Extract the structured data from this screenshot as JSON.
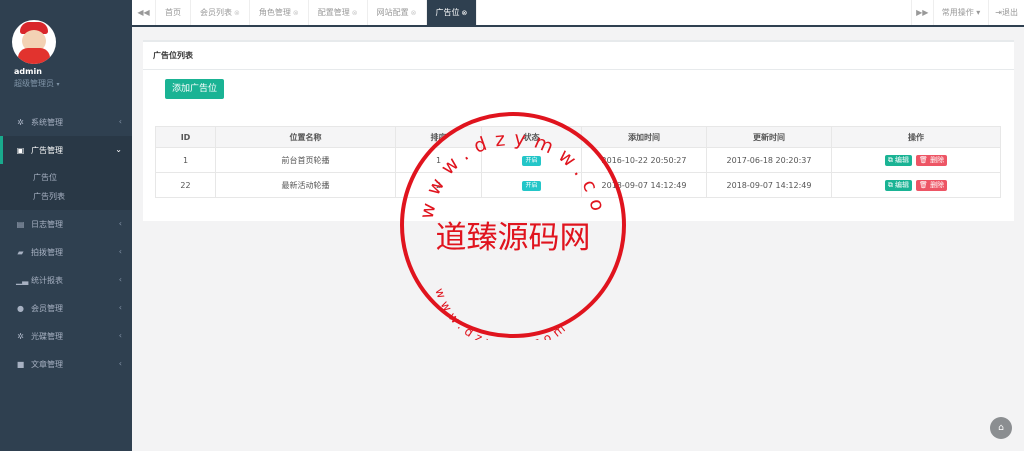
{
  "sidebar": {
    "user_name": "admin",
    "user_role": "超级管理员",
    "menu": [
      {
        "label": "系统管理",
        "icon": "gear-icon"
      },
      {
        "label": "广告管理",
        "icon": "image-icon"
      },
      {
        "label": "日志管理",
        "icon": "list-icon"
      },
      {
        "label": "拍拨管理",
        "icon": "book-icon"
      },
      {
        "label": "统计报表",
        "icon": "bar-chart-icon"
      },
      {
        "label": "会员管理",
        "icon": "user-icon"
      },
      {
        "label": "光碟管理",
        "icon": "gear-icon"
      },
      {
        "label": "文章管理",
        "icon": "list-icon"
      }
    ],
    "ad_submenu": [
      "广告位",
      "广告列表"
    ]
  },
  "tabs": {
    "items": [
      "首页",
      "会员列表",
      "角色管理",
      "配置管理",
      "网站配置",
      "广告位"
    ],
    "active_index": 5,
    "common_ops": "常用操作",
    "exit": "退出"
  },
  "panel": {
    "title": "广告位列表",
    "add_button": "添加广告位",
    "columns": [
      "ID",
      "位置名称",
      "排序",
      "状态",
      "添加时间",
      "更新时间",
      "操作"
    ],
    "rows": [
      {
        "id": "1",
        "name": "前台首页轮播",
        "sort": "1",
        "status": "开启",
        "created": "2016-10-22 20:50:27",
        "updated": "2017-06-18 20:20:37"
      },
      {
        "id": "22",
        "name": "最新活动轮播",
        "sort": "2",
        "status": "开启",
        "created": "2018-09-07 14:12:49",
        "updated": "2018-09-07 14:12:49"
      }
    ],
    "edit_label": "编辑",
    "delete_label": "删除"
  },
  "watermark": {
    "center_text": "道臻源码网",
    "ring_text": "www.dzymw.com"
  },
  "colors": {
    "sidebar_bg": "#2f4050",
    "accent_green": "#1ab394",
    "status_cyan": "#23c6c8",
    "danger_red": "#ed5565",
    "stamp_red": "#e0141e"
  }
}
